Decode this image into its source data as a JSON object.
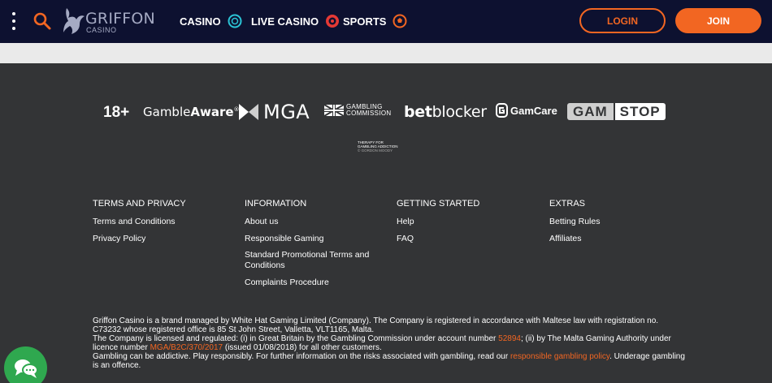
{
  "header": {
    "brand_name": "GRIFFON",
    "brand_sub": "CASINO",
    "nav": [
      {
        "label": "CASINO",
        "icon": "casino-chip-icon"
      },
      {
        "label": "LIVE CASINO",
        "icon": "roulette-icon"
      },
      {
        "label": "SPORTS",
        "icon": "sports-ball-icon"
      }
    ],
    "login_label": "LOGIN",
    "join_label": "JOIN"
  },
  "colors": {
    "header_bg": "#0d1130",
    "footer_bg": "#333436",
    "accent": "#f26622",
    "chat": "#2fa84f",
    "nav_icon_cyan": "#2bc4d6",
    "nav_icon_red": "#e53935"
  },
  "partners": {
    "age": "18+",
    "gambleaware_1": "Gamble",
    "gambleaware_2": "Aware",
    "gambleaware_reg": "®",
    "mga": "MGA",
    "gc_1": "GAMBLING",
    "gc_2": "COMMISSION",
    "betblocker_1": "bet",
    "betblocker_2": "blocker",
    "gamcare": "GamCare",
    "gamstop_1": "GAM",
    "gamstop_2": "STOP",
    "gordon_1": "THERAPY FOR",
    "gordon_2": "GAMBLING ADDICTION",
    "gordon_3": "© GORDON MOODY"
  },
  "footer": {
    "columns": [
      {
        "title": "TERMS AND PRIVACY",
        "links": [
          "Terms and Conditions",
          "Privacy Policy"
        ]
      },
      {
        "title": "INFORMATION",
        "links": [
          "About us",
          "Responsible Gaming",
          "Standard Promotional Terms and Conditions",
          "Complaints Procedure"
        ]
      },
      {
        "title": "GETTING STARTED",
        "links": [
          "Help",
          "FAQ"
        ]
      },
      {
        "title": "EXTRAS",
        "links": [
          "Betting Rules",
          "Affiliates"
        ]
      }
    ],
    "legal": {
      "p1": "Griffon Casino is a brand managed by White Hat Gaming Limited (Company). The Company is registered in accordance with Maltese law with registration no. C73232 whose registered office is 85 St John Street, Valletta, VLT1165, Malta.",
      "p2_a": "The Company is licensed and regulated: (i) in Great Britain by the Gambling Commission under account number ",
      "p2_link1": "52894",
      "p2_b": "; (ii) by The Malta Gaming Authority under licence number ",
      "p2_link2": "MGA/B2C/370/2017",
      "p2_c": " (issued 01/08/2018) for all other customers.",
      "p3_a": "Gambling can be addictive. Play responsibly. For further information on the risks associated with gambling, read our ",
      "p3_link": "responsible gambling policy",
      "p3_b": ". Underage gambling is an offence."
    }
  }
}
